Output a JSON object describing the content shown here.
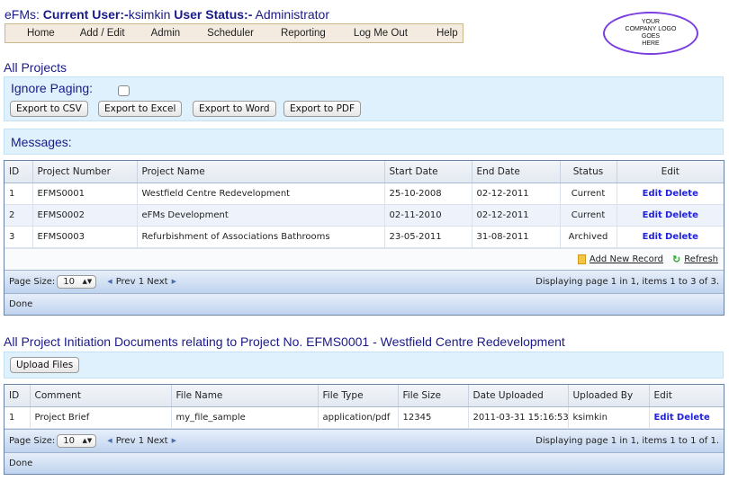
{
  "header": {
    "app": "eFMs:",
    "user_label": "Current User:-",
    "user": "ksimkin",
    "status_label": "User Status:-",
    "status": "Administrator"
  },
  "menu": [
    "Home",
    "Add / Edit",
    "Admin",
    "Scheduler",
    "Reporting",
    "Log Me Out",
    "Help"
  ],
  "logo": [
    "YOUR",
    "COMPANY LOGO",
    "GOES",
    "HERE"
  ],
  "projects_section": {
    "title": "All Projects",
    "ignore_paging_label": "Ignore Paging:",
    "ignore_paging_checked": false,
    "export_buttons": [
      "Export to CSV",
      "Export to Excel",
      "Export to Word",
      "Export to PDF"
    ],
    "messages_label": "Messages:"
  },
  "projects_grid": {
    "columns": [
      "ID",
      "Project Number",
      "Project Name",
      "Start Date",
      "End Date",
      "Status",
      "Edit"
    ],
    "rows": [
      {
        "id": "1",
        "number": "EFMS0001",
        "name": "Westfield Centre Redevelopment",
        "start": "25-10-2008",
        "end": "02-12-2011",
        "status": "Current",
        "edit": "Edit",
        "delete": "Delete"
      },
      {
        "id": "2",
        "number": "EFMS0002",
        "name": "eFMs Development",
        "start": "02-11-2010",
        "end": "02-12-2011",
        "status": "Current",
        "edit": "Edit",
        "delete": "Delete"
      },
      {
        "id": "3",
        "number": "EFMS0003",
        "name": "Refurbishment of Associations Bathrooms",
        "start": "23-05-2011",
        "end": "31-08-2011",
        "status": "Archived",
        "edit": "Edit",
        "delete": "Delete"
      }
    ],
    "add_new": "Add New Record",
    "refresh": "Refresh",
    "page_size_label": "Page Size:",
    "page_size": "10",
    "prev": "Prev",
    "page": "1",
    "next": "Next",
    "paging_info": "Displaying page 1 in 1, items 1 to 3 of 3.",
    "status": "Done"
  },
  "documents_section": {
    "title": "All Project Initiation Documents relating to Project No. EFMS0001 - Westfield Centre Redevelopment",
    "upload_button": "Upload Files"
  },
  "documents_grid": {
    "columns": [
      "ID",
      "Comment",
      "File Name",
      "File Type",
      "File Size",
      "Date Uploaded",
      "Uploaded By",
      "Edit"
    ],
    "rows": [
      {
        "id": "1",
        "comment": "Project Brief",
        "file_name": "my_file_sample",
        "file_type": "application/pdf",
        "file_size": "12345",
        "date": "2011-03-31 15:16:53",
        "by": "ksimkin",
        "edit": "Edit",
        "delete": "Delete"
      }
    ],
    "page_size_label": "Page Size:",
    "page_size": "10",
    "prev": "Prev",
    "page": "1",
    "next": "Next",
    "paging_info": "Displaying page 1 in 1, items 1 to 1 of 1.",
    "status": "Done"
  }
}
